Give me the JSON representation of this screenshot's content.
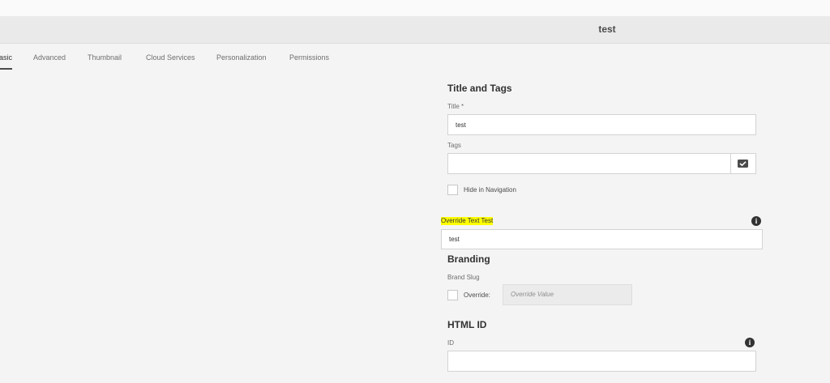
{
  "header": {
    "title": "test"
  },
  "tabs": [
    {
      "label": "asic"
    },
    {
      "label": "Advanced"
    },
    {
      "label": "Thumbnail"
    },
    {
      "label": "Cloud Services"
    },
    {
      "label": "Personalization"
    },
    {
      "label": "Permissions"
    }
  ],
  "title_and_tags": {
    "heading": "Title and Tags",
    "title_label": "Title *",
    "title_value": "test",
    "tags_label": "Tags",
    "tags_value": "",
    "tags_icon": "tag-picker-icon",
    "hide_in_nav_label": "Hide in Navigation"
  },
  "override": {
    "label": "Override Text Test",
    "value": "test",
    "info_icon": "info-icon"
  },
  "branding": {
    "heading": "Branding",
    "brand_slug_label": "Brand Slug",
    "override_checkbox_label": "Override:",
    "override_value_placeholder": "Override Value"
  },
  "html_id": {
    "heading": "HTML ID",
    "id_label": "ID",
    "id_value": "",
    "info_icon": "info-icon"
  },
  "colors": {
    "highlight": "#ffff00",
    "background": "#f4f4f4"
  }
}
